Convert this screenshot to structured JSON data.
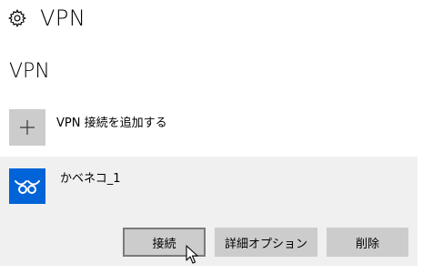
{
  "header": {
    "title": "VPN",
    "icon": "gear-icon"
  },
  "section": {
    "title": "VPN"
  },
  "add_vpn": {
    "label": "VPN 接続を追加する",
    "icon": "plus-icon",
    "tile_color": "#cccccc"
  },
  "connection": {
    "name": "かベネコ_1",
    "icon": "vpn-network-icon",
    "tile_color": "#0063d8",
    "panel_color": "#f0f0f0",
    "buttons": {
      "connect": "接続",
      "advanced": "詳細オプション",
      "delete": "削除"
    }
  }
}
